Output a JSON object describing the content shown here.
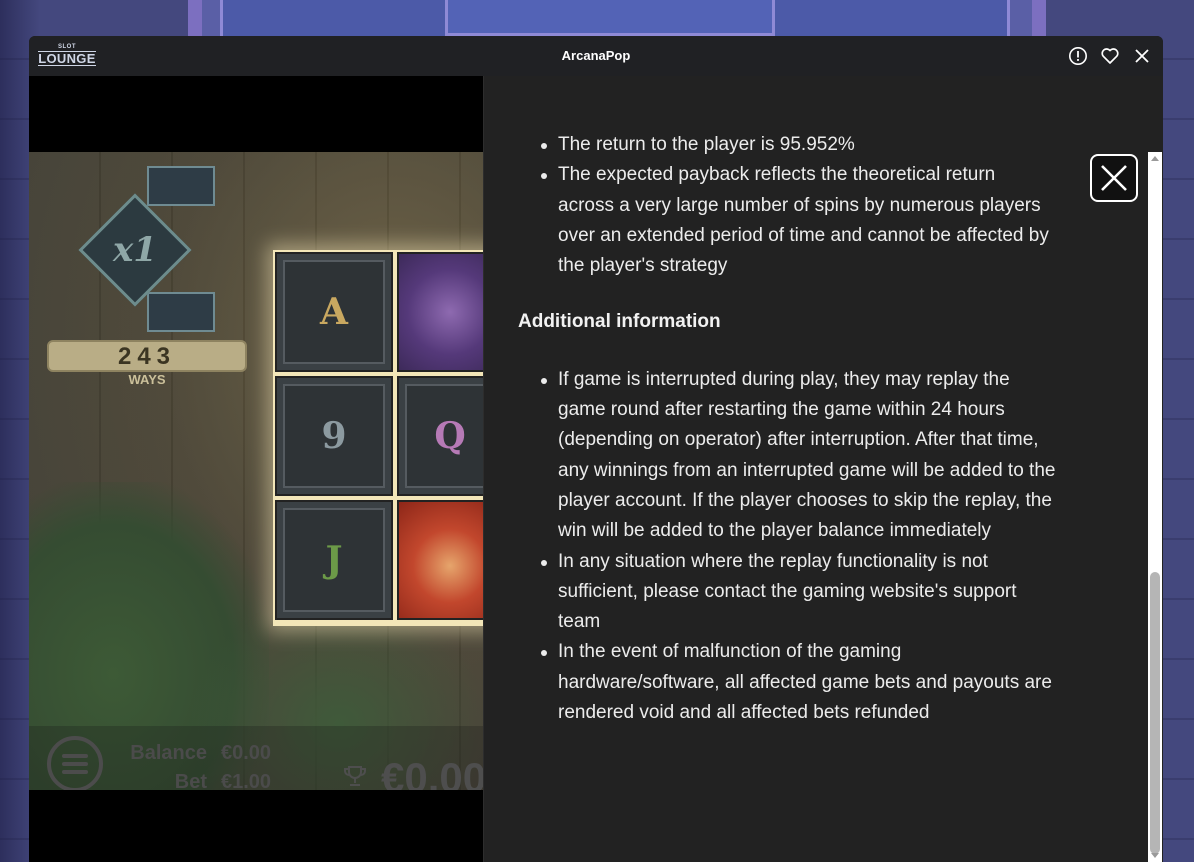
{
  "window": {
    "title": "ArcanaPop",
    "logo_small": "SLOT",
    "logo_big": "LOUNGE"
  },
  "titlebar_icons": [
    "info-icon",
    "heart-icon",
    "close-icon"
  ],
  "game": {
    "multiplier": "x1",
    "ways_count": "243",
    "ways_label": "WAYS",
    "reel_symbols": [
      "A",
      "9",
      "J",
      "Q"
    ],
    "balance_label": "Balance",
    "balance_value": "€0.00",
    "bet_label": "Bet",
    "bet_value": "€1.00",
    "win_value": "€0.00"
  },
  "info_panel": {
    "rtp_bullets": [
      "The return to the player is 95.952%",
      "The expected payback reflects the theoretical return across a very large number of spins by numerous players over an extended period of time and cannot be affected by the player's strategy"
    ],
    "additional_heading": "Additional information",
    "additional_bullets": [
      "If game is interrupted during play, they may replay the game round after restarting the game within 24 hours (depending on operator) after interruption. After that time, any winnings from an interrupted game will be added to the player account. If the player chooses to skip the replay, the win will be added to the player balance immediately",
      "In any situation where the replay functionality is not sufficient, please contact the gaming website's support team",
      "In the event of malfunction of the gaming hardware/software, all affected game bets and payouts are rendered void and all affected bets refunded"
    ]
  },
  "colors": {
    "panel_bg": "#222222",
    "titlebar_bg": "#202124",
    "text": "#ececec"
  }
}
